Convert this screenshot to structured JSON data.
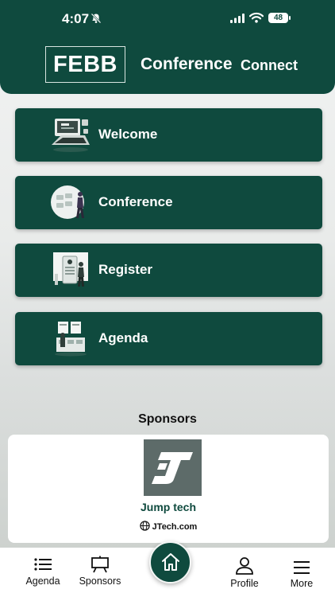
{
  "status_bar": {
    "time": "4:07",
    "battery": "48"
  },
  "header": {
    "logo_text": "FEBB",
    "title": "Conference",
    "subtitle": "Connect"
  },
  "menu": [
    {
      "label": "Welcome",
      "icon": "welcome-illustration"
    },
    {
      "label": "Conference",
      "icon": "conference-illustration"
    },
    {
      "label": "Register",
      "icon": "register-illustration"
    },
    {
      "label": "Agenda",
      "icon": "agenda-illustration"
    }
  ],
  "sponsors": {
    "heading": "Sponsors",
    "items": [
      {
        "name": "Jump tech",
        "website": "JTech.com"
      }
    ]
  },
  "tabbar": {
    "tabs": [
      {
        "label": "Agenda",
        "icon": "list-icon"
      },
      {
        "label": "Sponsors",
        "icon": "easel-icon"
      },
      {
        "label": "",
        "icon": "home-icon"
      },
      {
        "label": "Profile",
        "icon": "person-icon"
      },
      {
        "label": "More",
        "icon": "hamburger-icon"
      }
    ]
  },
  "colors": {
    "brand": "#0f4a3e",
    "background": "#eef0ef"
  }
}
